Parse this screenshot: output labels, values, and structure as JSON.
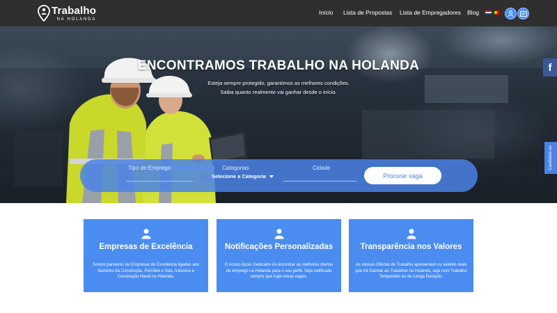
{
  "brand": {
    "logo_main": "Trabalho",
    "logo_sub": "NA HOLANDA"
  },
  "nav": {
    "items": [
      {
        "label": "Início"
      },
      {
        "label": "Lista de Propostas"
      },
      {
        "label": "Lista de Empregadores"
      },
      {
        "label": "Blog"
      }
    ],
    "flags": [
      "flag-netherlands-icon",
      "flag-portugal-icon"
    ],
    "icons": [
      "user-pin-icon",
      "id-card-icon"
    ]
  },
  "hero": {
    "title": "ENCONTRAMOS TRABALHO NA HOLANDA",
    "subtitle_line1": "Esteja sempre protegido, garantimos as melhores condições.",
    "subtitle_line2": "Saiba quanto realmente vai ganhar desde o início."
  },
  "search": {
    "job_type_label": "Tipo de Emprego",
    "job_type_value": "",
    "category_label": "Categorias",
    "category_value": "Selecione a Categoria",
    "city_label": "Cidade",
    "city_value": "",
    "button_label": "Procurar vaga"
  },
  "side": {
    "facebook_label": "f",
    "candidate_label": "Candidate-se"
  },
  "features": [
    {
      "title": "Empresas de Excelência",
      "description": "Somos parceiros de Empresas de Excelência ligadas aos Sectores da Construção, Petróleo e Gás, Indústria e Construção Naval na Holanda."
    },
    {
      "title": "Notificações Personalizadas",
      "description": "O nosso Apoio Dedicado irá encontrar as melhores ofertas de emprego na Holanda para o seu perfil. Seja notificado sempre que haja novas vagas."
    },
    {
      "title": "Transparência nos Valores",
      "description": "As nossas Ofertas de Trabalho apresentam os valores reais que irá Ganhar ao Trabalhar na Holanda, seja num Trabalho Temporário ou de Longa Duração."
    }
  ],
  "colors": {
    "navbar": "#2f2f2f",
    "accent_blue": "#4a8cf0",
    "facebook": "#3b5998"
  }
}
